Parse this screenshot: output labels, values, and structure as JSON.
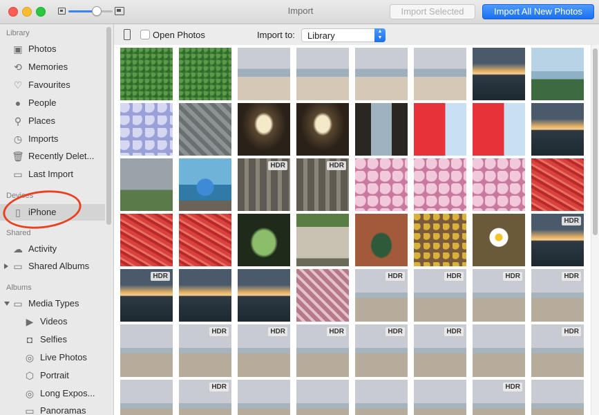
{
  "window": {
    "title": "Import",
    "import_selected_label": "Import Selected",
    "import_all_label": "Import All New Photos",
    "zoom_level": 0.55
  },
  "sidebar": {
    "sections": {
      "library": "Library",
      "devices": "Devices",
      "shared": "Shared",
      "albums": "Albums"
    },
    "library_items": [
      {
        "label": "Photos",
        "icon": "photos-icon"
      },
      {
        "label": "Memories",
        "icon": "memories-icon"
      },
      {
        "label": "Favourites",
        "icon": "heart-icon"
      },
      {
        "label": "People",
        "icon": "person-icon"
      },
      {
        "label": "Places",
        "icon": "pin-icon"
      },
      {
        "label": "Imports",
        "icon": "clock-icon"
      },
      {
        "label": "Recently Delet...",
        "icon": "trash-icon"
      },
      {
        "label": "Last Import",
        "icon": "album-icon"
      }
    ],
    "device": {
      "label": "iPhone",
      "icon": "phone-icon"
    },
    "shared_items": [
      {
        "label": "Activity",
        "icon": "cloud-icon"
      },
      {
        "label": "Shared Albums",
        "icon": "cloud-folder-icon"
      }
    ],
    "albums_items": [
      {
        "label": "Media Types",
        "icon": "folder-icon"
      },
      {
        "label": "Videos",
        "icon": "video-icon"
      },
      {
        "label": "Selfies",
        "icon": "camera-icon"
      },
      {
        "label": "Live Photos",
        "icon": "live-icon"
      },
      {
        "label": "Portrait",
        "icon": "cube-icon"
      },
      {
        "label": "Long Expos...",
        "icon": "long-exposure-icon"
      },
      {
        "label": "Panoramas",
        "icon": "panorama-icon"
      }
    ]
  },
  "toolbar": {
    "open_photos_label": "Open Photos",
    "import_to_label": "Import to:",
    "import_to_value": "Library"
  },
  "thumbnails": {
    "hdr_label": "HDR",
    "rows": [
      [
        {
          "t": "green",
          "hdr": false
        },
        {
          "t": "green",
          "hdr": false
        },
        {
          "t": "beach-kid",
          "hdr": false
        },
        {
          "t": "beach-kid",
          "hdr": false
        },
        {
          "t": "beach-kid",
          "hdr": false
        },
        {
          "t": "beach-kid",
          "hdr": false
        },
        {
          "t": "sunset-sea",
          "hdr": false
        },
        {
          "t": "coast-plant",
          "hdr": false
        }
      ],
      [
        {
          "t": "hydrangea-blue",
          "hdr": false
        },
        {
          "t": "rock-hand",
          "hdr": false
        },
        {
          "t": "window",
          "hdr": false
        },
        {
          "t": "window",
          "hdr": false
        },
        {
          "t": "doorway",
          "hdr": false
        },
        {
          "t": "lighthouse",
          "hdr": false
        },
        {
          "t": "lighthouse",
          "hdr": false
        },
        {
          "t": "sunset-sea",
          "hdr": false
        }
      ],
      [
        {
          "t": "cloud-hill",
          "hdr": false
        },
        {
          "t": "person-sea",
          "hdr": false
        },
        {
          "t": "posts",
          "hdr": true
        },
        {
          "t": "posts",
          "hdr": true
        },
        {
          "t": "hydrangea-pink",
          "hdr": false
        },
        {
          "t": "hydrangea-pink",
          "hdr": false
        },
        {
          "t": "hydrangea-pink",
          "hdr": false
        },
        {
          "t": "red-paint",
          "hdr": false
        }
      ],
      [
        {
          "t": "red-paint",
          "hdr": false
        },
        {
          "t": "red-paint",
          "hdr": false
        },
        {
          "t": "arch-green",
          "hdr": false
        },
        {
          "t": "garden-gate",
          "hdr": false
        },
        {
          "t": "brick-arch",
          "hdr": false
        },
        {
          "t": "lichen",
          "hdr": false
        },
        {
          "t": "daisy",
          "hdr": false
        },
        {
          "t": "sunset-sea",
          "hdr": true
        }
      ],
      [
        {
          "t": "sunset-sea",
          "hdr": true
        },
        {
          "t": "sunset-sea",
          "hdr": false
        },
        {
          "t": "sunset-sea",
          "hdr": false
        },
        {
          "t": "blanket",
          "hdr": false
        },
        {
          "t": "beach-grey",
          "hdr": true
        },
        {
          "t": "beach-grey",
          "hdr": true
        },
        {
          "t": "beach-grey",
          "hdr": true
        },
        {
          "t": "beach-grey",
          "hdr": true
        }
      ],
      [
        {
          "t": "beach-grey",
          "hdr": false
        },
        {
          "t": "beach-grey",
          "hdr": true
        },
        {
          "t": "beach-grey",
          "hdr": true
        },
        {
          "t": "beach-grey",
          "hdr": true
        },
        {
          "t": "beach-grey",
          "hdr": true
        },
        {
          "t": "beach-grey",
          "hdr": true
        },
        {
          "t": "beach-grey",
          "hdr": false
        },
        {
          "t": "beach-grey",
          "hdr": true
        }
      ],
      [
        {
          "t": "beach-grey",
          "hdr": false
        },
        {
          "t": "beach-grey",
          "hdr": true
        },
        {
          "t": "beach-grey",
          "hdr": false
        },
        {
          "t": "beach-grey",
          "hdr": false
        },
        {
          "t": "beach-grey",
          "hdr": false
        },
        {
          "t": "beach-grey",
          "hdr": false
        },
        {
          "t": "beach-grey",
          "hdr": true
        },
        {
          "t": "beach-grey",
          "hdr": false
        }
      ]
    ]
  },
  "colors": {
    "accent": "#1b6ff0",
    "annotation": "#e94122",
    "sidebar_bg": "#e9e9e9"
  }
}
